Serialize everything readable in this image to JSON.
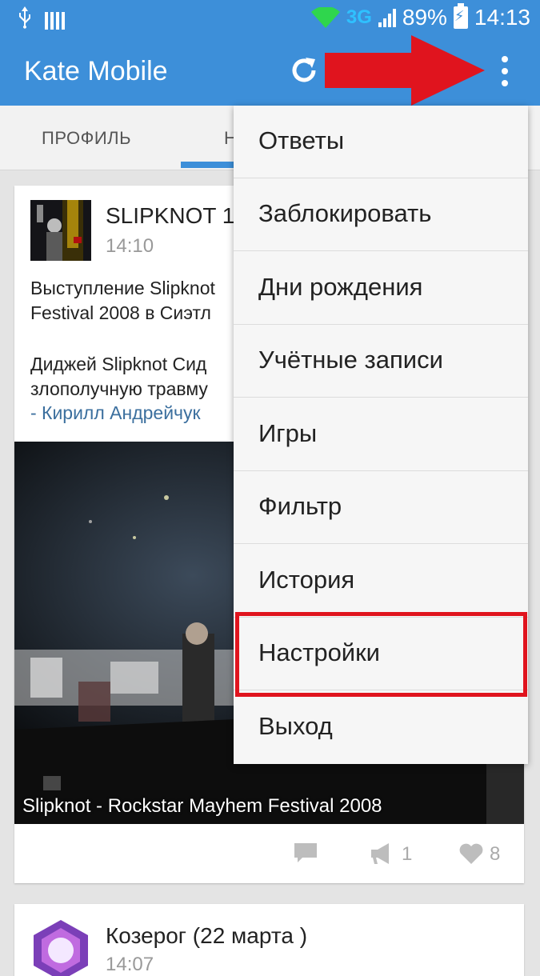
{
  "status_bar": {
    "network": "3G",
    "battery": "89%",
    "time": "14:13"
  },
  "app_bar": {
    "title": "Kate Mobile"
  },
  "tabs": [
    {
      "label": "ПРОФИЛЬ"
    },
    {
      "label": "Н"
    }
  ],
  "post": {
    "author": "SLIPKNOT 1",
    "time": "14:10",
    "text_lines_1": [
      "Выступление Slipknot",
      "Festival 2008 в Сиэтл"
    ],
    "text_lines_2": [
      "Диджей Slipknot Сид",
      "злополучную травму"
    ],
    "link": "- Кирилл Андрейчук",
    "video_caption": "Slipknot - Rockstar Mayhem Festival 2008",
    "repost_count": "1",
    "like_count": "8"
  },
  "post2": {
    "author": "Козерог  (22 марта )",
    "time": "14:07"
  },
  "menu": {
    "items": [
      {
        "label": "Ответы"
      },
      {
        "label": "Заблокировать"
      },
      {
        "label": "Дни рождения"
      },
      {
        "label": "Учётные записи"
      },
      {
        "label": "Игры"
      },
      {
        "label": "Фильтр"
      },
      {
        "label": "История"
      },
      {
        "label": "Настройки"
      },
      {
        "label": "Выход"
      }
    ],
    "highlighted": "Настройки"
  },
  "colors": {
    "app_bar": "#3d8fd9",
    "highlight": "#e0141e",
    "link": "#3b6f9e"
  },
  "icons": [
    "usb-icon",
    "sim-icon",
    "wifi-icon",
    "signal-icon",
    "battery-icon",
    "refresh-icon",
    "overflow-menu-icon",
    "comment-icon",
    "repost-icon",
    "like-icon"
  ]
}
